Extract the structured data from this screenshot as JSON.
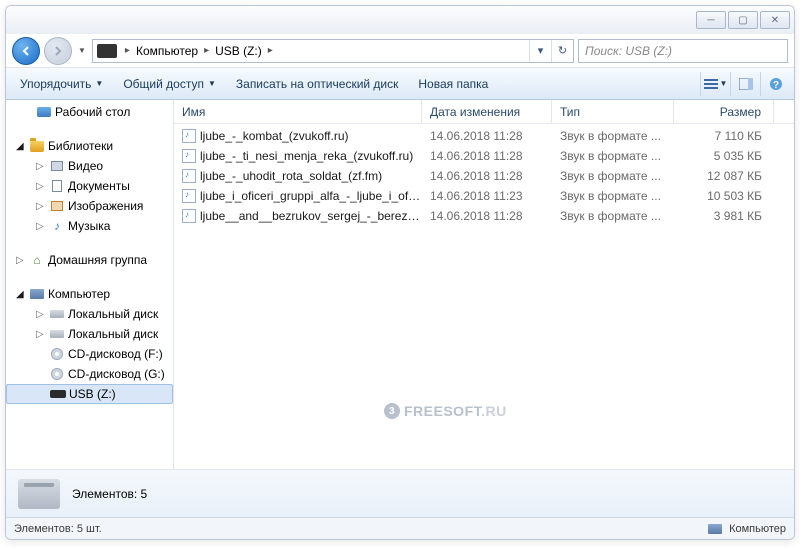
{
  "breadcrumb": {
    "segments": [
      "Компьютер",
      "USB (Z:)"
    ]
  },
  "search": {
    "placeholder": "Поиск: USB (Z:)"
  },
  "toolbar": {
    "organize": "Упорядочить",
    "share": "Общий доступ",
    "burn": "Записать на оптический диск",
    "newfolder": "Новая папка"
  },
  "columns": {
    "name": "Имя",
    "date": "Дата изменения",
    "type": "Тип",
    "size": "Размер"
  },
  "sidebar": {
    "desktop": "Рабочий стол",
    "libraries": "Библиотеки",
    "video": "Видео",
    "documents": "Документы",
    "pictures": "Изображения",
    "music": "Музыка",
    "homegroup": "Домашняя группа",
    "computer": "Компьютер",
    "localdisk1": "Локальный диск",
    "localdisk2": "Локальный диск",
    "cdf": "CD-дисковод (F:)",
    "cdg": "CD-дисковод (G:)",
    "usb": "USB (Z:)"
  },
  "files": [
    {
      "name": "ljube_-_kombat_(zvukoff.ru)",
      "date": "14.06.2018 11:28",
      "type": "Звук в формате ...",
      "size": "7 110 КБ"
    },
    {
      "name": "ljube_-_ti_nesi_menja_reka_(zvukoff.ru)",
      "date": "14.06.2018 11:28",
      "type": "Звук в формате ...",
      "size": "5 035 КБ"
    },
    {
      "name": "ljube_-_uhodit_rota_soldat_(zf.fm)",
      "date": "14.06.2018 11:28",
      "type": "Звук в формате ...",
      "size": "12 087 КБ"
    },
    {
      "name": "ljube_i_oficeri_gruppi_alfa_-_ljube_i_ofice...",
      "date": "14.06.2018 11:23",
      "type": "Звук в формате ...",
      "size": "10 503 КБ"
    },
    {
      "name": "ljube__and__bezrukov_sergej_-_berezi_(zv...",
      "date": "14.06.2018 11:28",
      "type": "Звук в формате ...",
      "size": "3 981 КБ"
    }
  ],
  "details": {
    "label": "Элементов: 5"
  },
  "status": {
    "left": "Элементов: 5 шт.",
    "right": "Компьютер"
  },
  "watermark": {
    "num": "3",
    "t1": "FREESOFT",
    "t2": ".RU"
  }
}
